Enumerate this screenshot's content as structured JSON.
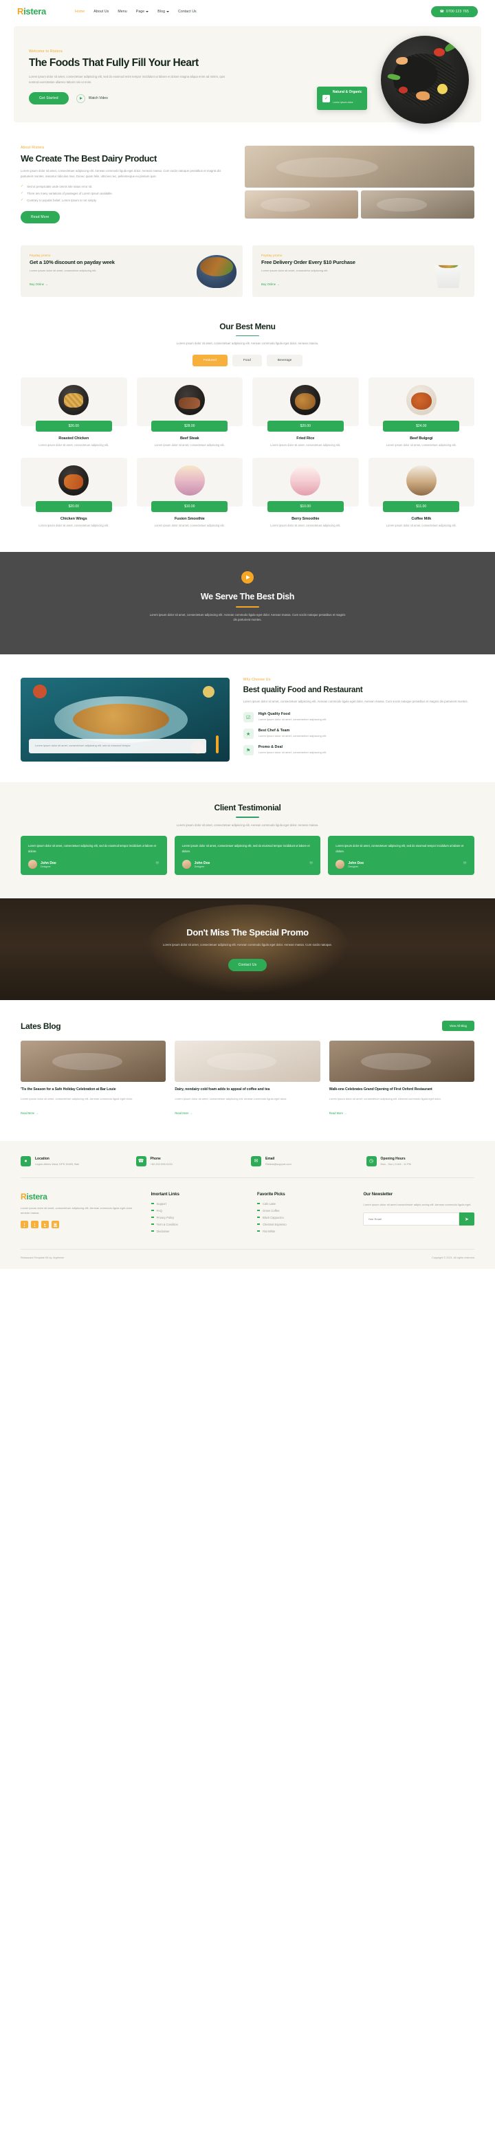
{
  "brand": {
    "prefix": "R",
    "rest": "istera"
  },
  "nav": {
    "items": [
      {
        "label": "Home",
        "active": true,
        "caret": false
      },
      {
        "label": "About Us",
        "active": false,
        "caret": false
      },
      {
        "label": "Menu",
        "active": false,
        "caret": false
      },
      {
        "label": "Page",
        "active": false,
        "caret": true
      },
      {
        "label": "Blog",
        "active": false,
        "caret": true
      },
      {
        "label": "Contact Us",
        "active": false,
        "caret": false
      }
    ],
    "phone_button": "0700 123 765",
    "phone_icon": "phone-icon"
  },
  "hero": {
    "eyebrow": "Welcome to Ristera",
    "title": "The Foods That Fully Fill Your Heart",
    "body": "Lorem ipsum dolor sit amet, consectetuer adipiscing elit, sed do eiusmod enim tempor incididunt ut labore et dolore magna aliqua enim ad minim, quis nostrud exercitation ullamco laboris nisi ut enim.",
    "primary_button": "Get Started",
    "video_button": "Watch Video",
    "badge_title": "Natural & Organic",
    "badge_sub": "Lorem ipsum dolor",
    "badge_icon": "leaf-icon"
  },
  "about": {
    "eyebrow": "About Ristera",
    "title": "We Create The Best Dairy Product",
    "body": "Lorem ipsum dolor sit amet, consectetuer adipiscing elit. Aenean commodo ligula eget dolor. Aenean massa. Cum sociis natoque penatibus et magnis dis parturient montes, nascetur ridiculus mus. Donec quam felis, ultricies nec, pellentesque eu pretium quis.",
    "checks": [
      "Sed ut perspiciatis unde omnis iste natus error sit.",
      "There are many variations of passages of Lorem Ipsum available.",
      "Contrary to popular belief, Lorem Ipsum is not simply."
    ],
    "check_icon": "check-icon",
    "button": "Read More"
  },
  "promos": [
    {
      "eyebrow": "Payday promo",
      "title": "Get a 10% discount on payday week",
      "body": "Lorem ipsum dolor sit amet, consectetur adipiscing elit.",
      "link": "Buy Online",
      "link_icon": "arrow-right-icon",
      "image": "noodle-bowl-image"
    },
    {
      "eyebrow": "Payday promo",
      "title": "Free Delivery Order Every $10 Purchase",
      "body": "Lorem ipsum dolor sit amet, consectetur adipiscing elit.",
      "link": "Buy Online",
      "link_icon": "arrow-right-icon",
      "image": "takeout-box-image"
    }
  ],
  "menu": {
    "title": "Our Best Menu",
    "subtitle": "Lorem ipsum dolor sit amet, consectetuer adipiscing elit. Aenean commodo ligula eget dolor. Aenean massa.",
    "tabs": [
      {
        "label": "Featured",
        "active": true
      },
      {
        "label": "Food",
        "active": false
      },
      {
        "label": "Beverage",
        "active": false
      }
    ],
    "items": [
      {
        "name": "Roasted Chicken",
        "price": "$26.00",
        "desc": "Lorem ipsum dolor sit amet, consectetuer adipiscing elit.",
        "image": "roasted-chicken-image"
      },
      {
        "name": "Beef Steak",
        "price": "$28.00",
        "desc": "Lorem ipsum dolor sit amet, consectetuer adipiscing elit.",
        "image": "beef-steak-image"
      },
      {
        "name": "Fried Rice",
        "price": "$20.00",
        "desc": "Lorem ipsum dolor sit amet, consectetuer adipiscing elit.",
        "image": "fried-rice-image"
      },
      {
        "name": "Beef Bulgogi",
        "price": "$24.00",
        "desc": "Lorem ipsum dolor sit amet, consectetuer adipiscing elit.",
        "image": "beef-bulgogi-image"
      },
      {
        "name": "Chicken Wings",
        "price": "$20.00",
        "desc": "Lorem ipsum dolor sit amet, consectetuer adipiscing elit.",
        "image": "chicken-wings-image"
      },
      {
        "name": "Fusion Smoothie",
        "price": "$10.00",
        "desc": "Lorem ipsum dolor sit amet, consectetuer adipiscing elit.",
        "image": "fusion-smoothie-image"
      },
      {
        "name": "Berry Smoothie",
        "price": "$10.00",
        "desc": "Lorem ipsum dolor sit amet, consectetuer adipiscing elit.",
        "image": "berry-smoothie-image"
      },
      {
        "name": "Coffee Milk",
        "price": "$11.00",
        "desc": "Lorem ipsum dolor sit amet, consectetuer adipiscing elit.",
        "image": "coffee-milk-image"
      }
    ]
  },
  "video": {
    "play_icon": "play-icon",
    "title": "We Serve The Best Dish",
    "body": "Lorem ipsum dolor sit amet, consectetuer adipiscing elit. Aenean commodo ligula eget dolor. Aenean massa. Cum sociis natoque penatibus et magnis dis parturient montes."
  },
  "quality": {
    "eyebrow": "Why Choose Us",
    "title": "Best quality Food and Restaurant",
    "body": "Lorem ipsum dolor sit amet, consectetuer adipiscing elit. Aenean commodo ligula eget dolor. Aenean massa. Cum sociis natoque penatibus et magnis dis parturient montes.",
    "quote": "Lorem ipsum dolor sit amet, consectetuer adipiscing elit, sed do eiusmod tempor.",
    "features": [
      {
        "title": "High Quality Food",
        "desc": "Lorem ipsum dolor sit amet, consectetuer adipiscing elit.",
        "icon": "food-quality-icon"
      },
      {
        "title": "Best Chef & Team",
        "desc": "Lorem ipsum dolor sit amet, consectetuer adipiscing elit.",
        "icon": "chef-icon"
      },
      {
        "title": "Promo & Deal",
        "desc": "Lorem ipsum dolor sit amet, consectetuer adipiscing elit.",
        "icon": "tag-icon"
      }
    ]
  },
  "testimonial": {
    "title": "Client Testimonial",
    "subtitle": "Lorem ipsum dolor sit amet, consectetuer adipiscing elit. Aenean commodo ligula eget dolor. Aenean massa.",
    "cards": [
      {
        "quote": "Lorem ipsum dolor sit amet, consectetuer adipiscing elit, sed do eiusmod tempor incididunt ut labore et dolore.",
        "name": "John Doe",
        "role": "Designer"
      },
      {
        "quote": "Lorem ipsum dolor sit amet, consectetuer adipiscing elit, sed do eiusmod tempor incididunt ut labore et dolore.",
        "name": "John Doe",
        "role": "Designer"
      },
      {
        "quote": "Lorem ipsum dolor sit amet, consectetuer adipiscing elit, sed do eiusmod tempor incididunt ut labore et dolore.",
        "name": "John Doe",
        "role": "Designer"
      }
    ],
    "quote_mark": "\""
  },
  "banner": {
    "title": "Don't Miss The Special Promo",
    "body": "Lorem ipsum dolor sit amet, consectetuer adipiscing elit. Aenean commodo ligula eget dolor. Aenean massa. Cum sociis natoque.",
    "button": "Contact Us"
  },
  "blog": {
    "title": "Lates Blog",
    "button": "View All Blog",
    "posts": [
      {
        "title": "'Tis the Season for a Safe Holiday Celebration at Bar Louie",
        "body": "Lorem ipsum dolor sit amet, consectetuer adipiscing elit. Aenean commodo ligula eget dolor.",
        "link": "Read More",
        "image": "blog-image-1"
      },
      {
        "title": "Dairy, nondairy cold foam adds to appeal of coffee and tea",
        "body": "Lorem ipsum dolor sit amet, consectetuer adipiscing elit. Aenean commodo ligula eget dolor.",
        "link": "Read More",
        "image": "blog-image-2"
      },
      {
        "title": "Walk-ons Celebrates Grand Opening of First Oxford Restaurant",
        "body": "Lorem ipsum dolor sit amet, consectetuer adipiscing elit. Aenean commodo ligula eget dolor.",
        "link": "Read More",
        "image": "blog-image-3"
      }
    ]
  },
  "footer": {
    "contacts": [
      {
        "title": "Location",
        "value": "Legian Atkins West, DPS 15493, Bali",
        "icon": "location-pin-icon"
      },
      {
        "title": "Phone",
        "value": "+62-202-555-0133",
        "icon": "phone-icon"
      },
      {
        "title": "Email",
        "value": "Ristera@support.com",
        "icon": "envelope-icon"
      },
      {
        "title": "Opening Hours",
        "value": "Mon - Sun | 9 AM - 11 PM",
        "icon": "clock-icon"
      }
    ],
    "about": "Lorem ipsum dolor sit amet, consectetuer adipiscing elit. Aenean commodo ligula eget dolor aenean massa.",
    "socials": [
      {
        "name": "facebook-icon",
        "glyph": "f"
      },
      {
        "name": "twitter-icon",
        "glyph": "t"
      },
      {
        "name": "youtube-icon",
        "glyph": "▸"
      },
      {
        "name": "instagram-icon",
        "glyph": "▣"
      }
    ],
    "links_title": "Imortant Links",
    "links": [
      "Support",
      "FAQ",
      "Privacy Policy",
      "Term & Condition",
      "Disclaimer"
    ],
    "picks_title": "Favorite Picks",
    "picks": [
      "Cafe Latte",
      "Green Coffee",
      "Black Cappucino",
      "Chestnut Espresso",
      "Flat White"
    ],
    "newsletter_title": "Our Newsletter",
    "newsletter_body": "Lorem ipsum dolor sit amet consectetuer adipis arcing elit. Aenean commodo ligula eget.",
    "newsletter_placeholder": "Your Email",
    "newsletter_icon": "send-icon",
    "credit": "Restaurant Template Kit by Jegtheme",
    "copyright": "Copyright © 2021. All rights reserved"
  },
  "colors": {
    "green": "#2eab57",
    "orange": "#f5a623",
    "dark": "#4b4b4b",
    "cream": "#f7f6f1"
  }
}
